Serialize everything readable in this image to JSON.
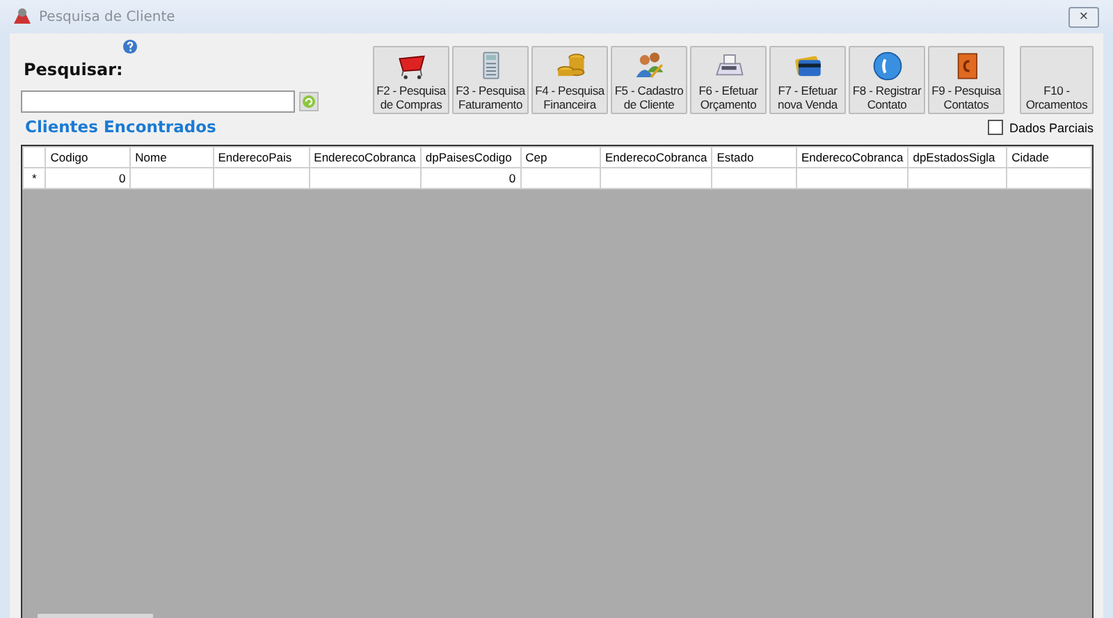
{
  "window": {
    "title": "Pesquisa de Cliente",
    "close": "×"
  },
  "search": {
    "label": "Pesquisar:"
  },
  "toolbar": [
    {
      "kind": "basket",
      "label": "F2 - Pesquisa de Compras"
    },
    {
      "kind": "calculator",
      "label": "F3 - Pesquisa Faturamento"
    },
    {
      "kind": "coins",
      "label": "F4 - Pesquisa Financeira"
    },
    {
      "kind": "people",
      "label": "F5 - Cadastro de Cliente"
    },
    {
      "kind": "register",
      "label": "F6 - Efetuar Orçamento"
    },
    {
      "kind": "cards",
      "label": "F7 - Efetuar nova Venda"
    },
    {
      "kind": "phone",
      "label": "F8 - Registrar Contato"
    },
    {
      "kind": "book",
      "label": "F9 - Pesquisa Contatos"
    },
    {
      "kind": "plain",
      "label": "F10 - Orcamentos"
    }
  ],
  "results": {
    "title": "Clientes Encontrados",
    "partial": {
      "label": "Dados Parciais",
      "checked": false
    }
  },
  "table": {
    "columns": [
      "Codigo",
      "Nome",
      "EnderecoPais",
      "EnderecoCobranca",
      "dpPaisesCodigo",
      "Cep",
      "EnderecoCobranca",
      "Estado",
      "EnderecoCobranca",
      "dpEstadosSigla",
      "Cidade"
    ],
    "rows": [
      {
        "marker": "*",
        "cells": [
          "0",
          "",
          "",
          "",
          "0",
          "",
          "",
          "",
          "",
          "",
          ""
        ]
      }
    ]
  }
}
